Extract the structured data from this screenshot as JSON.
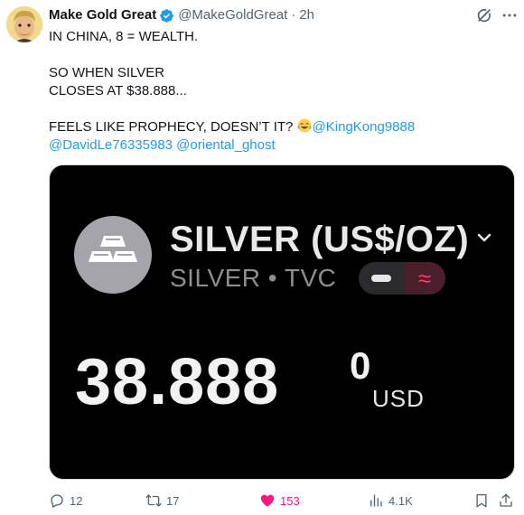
{
  "author": {
    "name": "Make Gold Great",
    "handle": "@MakeGoldGreat",
    "separator": "·",
    "time": "2h"
  },
  "tweet": {
    "line1": "IN CHINA, 8 = WEALTH.",
    "line2": "SO WHEN SILVER",
    "line3": "CLOSES AT $38.888...",
    "line4": "FEELS LIKE PROPHECY, DOESN’T IT?",
    "emoji": "face-with-tears-of-joy",
    "mention1": "@KingKong9888",
    "mention2": "@DavidLe76335983",
    "mention3": "@oriental_ghost"
  },
  "media": {
    "title": "SILVER (US$/OZ)",
    "subtitle": "SILVER • TVC",
    "price": "38.888",
    "price_superscript": "0",
    "currency": "USD",
    "toggle_right_glyph": "≈",
    "colors": {
      "background": "#000000",
      "accent": "#ff3b5c"
    }
  },
  "actions": {
    "replies": "12",
    "reposts": "17",
    "likes": "153",
    "views": "4.1K"
  },
  "colors": {
    "link": "#1d9bf0",
    "like": "#f91880",
    "muted": "#536471"
  }
}
